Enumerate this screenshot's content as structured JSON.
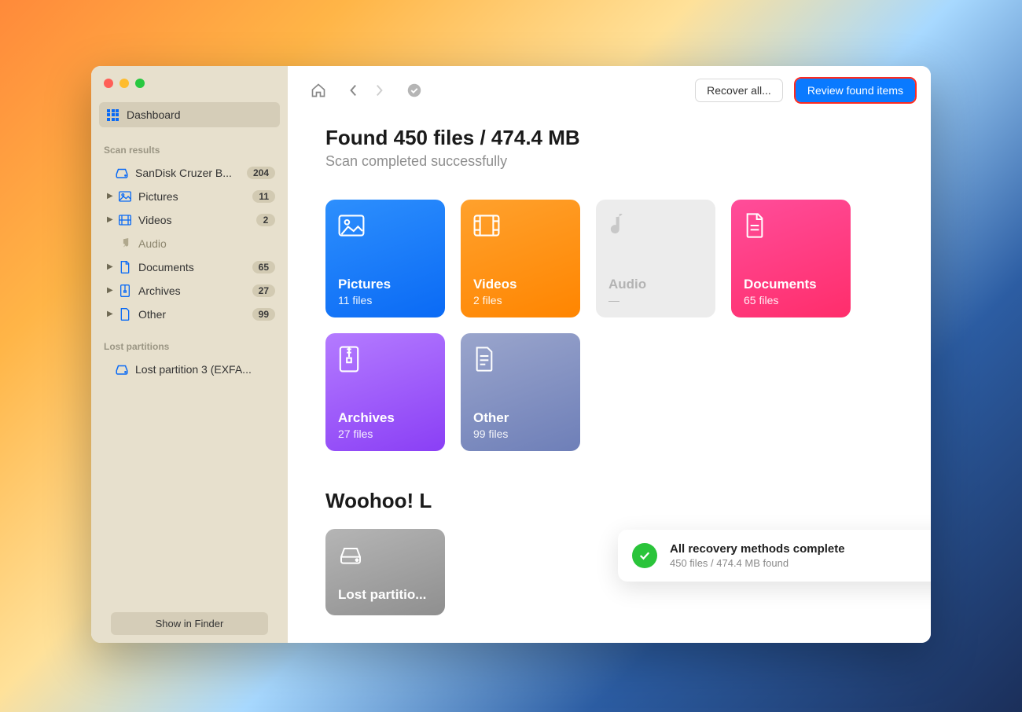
{
  "sidebar": {
    "dashboard_label": "Dashboard",
    "section_results": "Scan results",
    "drive": {
      "label": "SanDisk Cruzer B...",
      "badge": "204"
    },
    "items": [
      {
        "label": "Pictures",
        "badge": "11"
      },
      {
        "label": "Videos",
        "badge": "2"
      },
      {
        "label": "Audio",
        "badge": ""
      },
      {
        "label": "Documents",
        "badge": "65"
      },
      {
        "label": "Archives",
        "badge": "27"
      },
      {
        "label": "Other",
        "badge": "99"
      }
    ],
    "section_lost": "Lost partitions",
    "lost_item": "Lost partition 3 (EXFA...",
    "show_finder": "Show in Finder"
  },
  "toolbar": {
    "recover_label": "Recover all...",
    "review_label": "Review found items"
  },
  "main": {
    "title": "Found 450 files / 474.4 MB",
    "subtitle": "Scan completed successfully",
    "tiles": {
      "pictures": {
        "title": "Pictures",
        "sub": "11 files"
      },
      "videos": {
        "title": "Videos",
        "sub": "2 files"
      },
      "audio": {
        "title": "Audio",
        "sub": "—"
      },
      "documents": {
        "title": "Documents",
        "sub": "65 files"
      },
      "archives": {
        "title": "Archives",
        "sub": "27 files"
      },
      "other": {
        "title": "Other",
        "sub": "99 files"
      }
    },
    "woohoo": "Woohoo! L",
    "lost_tile": "Lost partitio..."
  },
  "toast": {
    "title": "All recovery methods complete",
    "sub": "450 files / 474.4 MB found"
  }
}
